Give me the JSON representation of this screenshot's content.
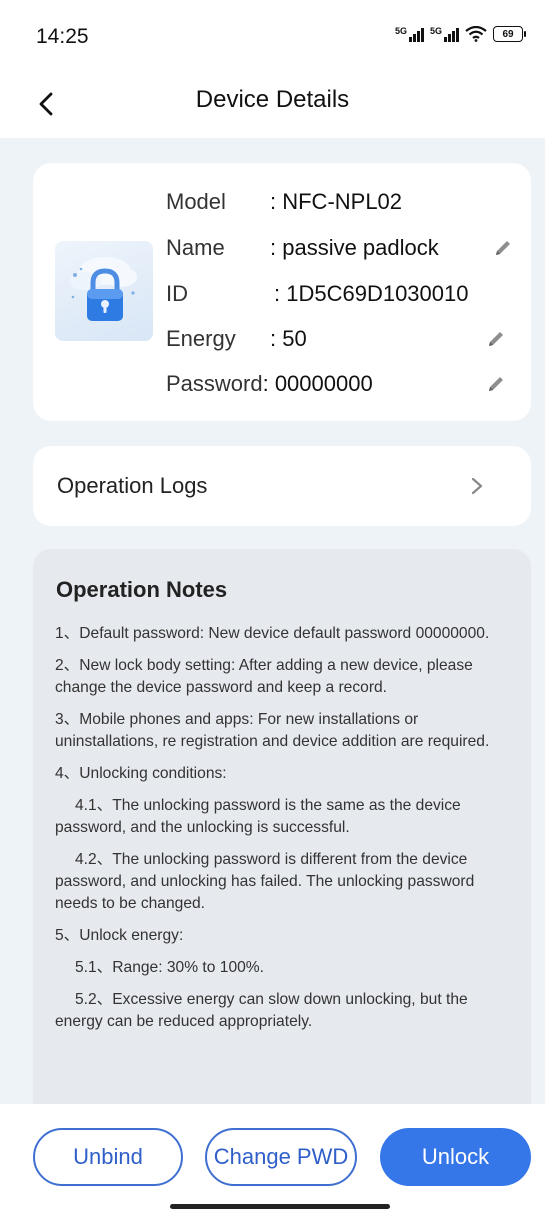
{
  "status_bar": {
    "time": "14:25",
    "signal1_label": "5G",
    "signal2_label": "5G",
    "battery_level": "69"
  },
  "header": {
    "title": "Device Details",
    "back_icon": "chevron-left-icon"
  },
  "device": {
    "model_label": "Model",
    "model_value": ": NFC-NPL02",
    "name_label": "Name",
    "name_value": ": passive padlock",
    "id_label": "ID",
    "id_value": ": 1D5C69D1030010",
    "energy_label": "Energy",
    "energy_value": ": 50",
    "password_label": "Password",
    "password_value": ": 00000000"
  },
  "logs": {
    "label": "Operation Logs"
  },
  "notes": {
    "title": "Operation Notes",
    "items": [
      "1、Default password: New device default password 00000000.",
      "2、New lock body setting: After adding a new device, please change the device password and keep a record.",
      "3、Mobile phones and apps: For new installations or uninstallations, re registration and device addition are required.",
      "4、Unlocking conditions:",
      "4.1、The unlocking password is the same as the device password, and the unlocking is successful.",
      "4.2、The unlocking password is different from the device password, and unlocking has failed. The unlocking password needs to be changed.",
      "5、Unlock energy:",
      "5.1、Range: 30% to 100%.",
      "5.2、Excessive energy can slow down unlocking, but the energy can be reduced appropriately."
    ]
  },
  "actions": {
    "unbind": "Unbind",
    "change_pwd": "Change PWD",
    "unlock": "Unlock"
  },
  "colors": {
    "primary": "#3577e8",
    "content_bg": "#eef3f7",
    "notes_bg": "#e6e9ee"
  }
}
